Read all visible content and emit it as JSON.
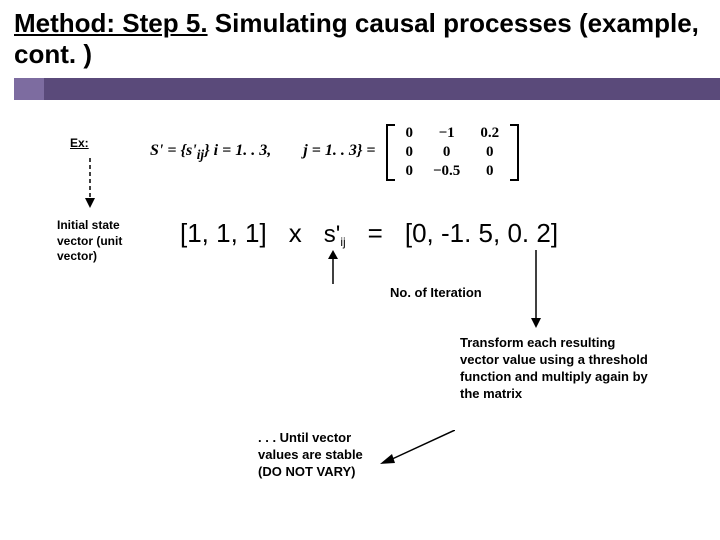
{
  "title": {
    "underlined": "Method: Step 5.",
    "rest": " Simulating causal processes (example, cont. )"
  },
  "ex_label": "Ex:",
  "formula": {
    "lhs": "S' = {s'",
    "sub1": "ij",
    "mid1": "}   i = 1. . 3,",
    "mid2": "j = 1. . 3}  ="
  },
  "matrix": {
    "rows": [
      [
        "0",
        "−1",
        "0.2"
      ],
      [
        "0",
        "0",
        "0"
      ],
      [
        "0",
        "−0.5",
        "0"
      ]
    ]
  },
  "initial_label": "Initial state vector (unit vector)",
  "equation": {
    "vector": "[1, 1, 1]",
    "times": "x",
    "s_main": "s'",
    "s_sub": "ij",
    "equals": "=",
    "result": "[0, -1. 5, 0. 2]"
  },
  "iteration_label": "No. of Iteration",
  "transform_label": "Transform each resulting vector value using a threshold function and multiply again by the matrix",
  "until_label": ". . . Until vector values are stable (DO NOT VARY)"
}
